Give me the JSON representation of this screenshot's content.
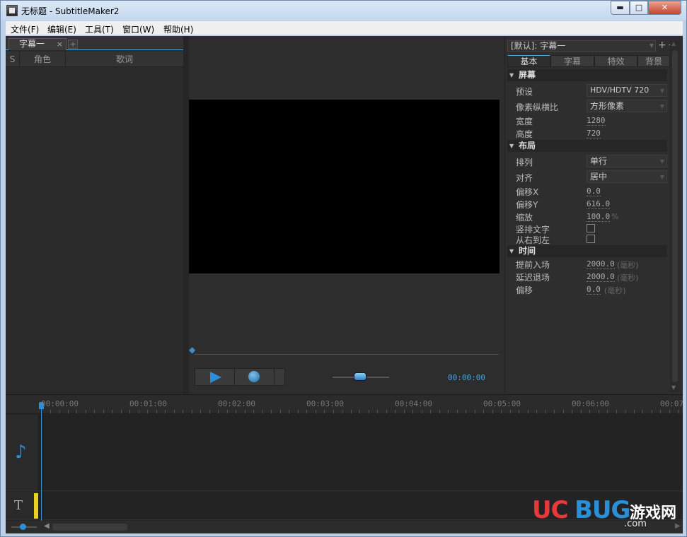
{
  "window": {
    "title": "无标题 - SubtitleMaker2",
    "min_glyph": "▬",
    "max_glyph": "□",
    "close_glyph": "✕"
  },
  "menu": [
    {
      "label": "文件(F)"
    },
    {
      "label": "编辑(E)"
    },
    {
      "label": "工具(T)"
    },
    {
      "label": "窗口(W)"
    },
    {
      "label": "帮助(H)"
    }
  ],
  "left_panel": {
    "tab_label": "字幕一",
    "tab_close": "×",
    "tab_add": "+",
    "columns": [
      "S",
      "角色",
      "歌词"
    ]
  },
  "player": {
    "time": "00:00:00",
    "volume": 0.5
  },
  "right_panel": {
    "preset": "[默认]: 字幕一",
    "preset_add": "+",
    "preset_remove": "−",
    "tabs": [
      "基本",
      "字幕",
      "特效",
      "背景"
    ],
    "active_tab": "基本",
    "sections": {
      "screen": "屏幕",
      "layout": "布局",
      "time": "时间"
    },
    "screen": {
      "preset_label": "预设",
      "preset_value": "HDV/HDTV 720",
      "aspect_label": "像素纵横比",
      "aspect_value": "方形像素",
      "width_label": "宽度",
      "width_value": "1280",
      "height_label": "高度",
      "height_value": "720"
    },
    "layout": {
      "arrange_label": "排列",
      "arrange_value": "单行",
      "align_label": "对齐",
      "align_value": "居中",
      "offx_label": "偏移X",
      "offx_value": "0.0",
      "offy_label": "偏移Y",
      "offy_value": "616.0",
      "scale_label": "缩放",
      "scale_value": "100.0",
      "scale_unit": "%",
      "vertical_label": "竖排文字",
      "rtl_label": "从右到左"
    },
    "time": {
      "enter_label": "提前入场",
      "enter_value": "2000.0",
      "enter_unit": "(毫秒)",
      "exit_label": "延迟退场",
      "exit_value": "2000.0",
      "exit_unit": "(毫秒)",
      "offset_label": "偏移",
      "offset_value": "0.0",
      "offset_unit": "(毫秒)"
    }
  },
  "timeline": {
    "ticks": [
      "00:00:00",
      "00:01:00",
      "00:02:00",
      "00:03:00",
      "00:04:00",
      "00:05:00",
      "00:06:00",
      "00:07"
    ],
    "audio_icon": "♪",
    "text_icon": "T"
  },
  "watermark": {
    "uc": "UC",
    "bug": "BUG",
    "cn": "游戏网",
    "com": ".com"
  }
}
